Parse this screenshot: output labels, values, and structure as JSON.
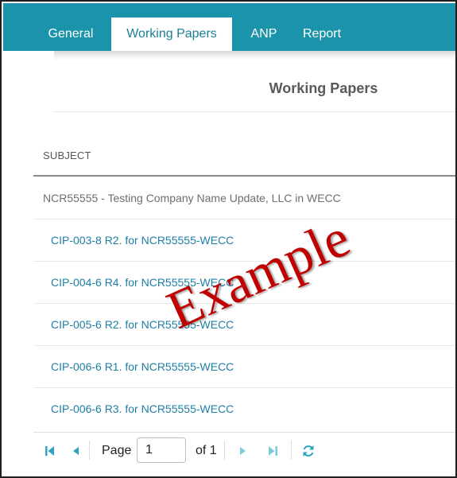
{
  "tabs": [
    {
      "label": "General",
      "active": false
    },
    {
      "label": "Working Papers",
      "active": true
    },
    {
      "label": "ANP",
      "active": false
    },
    {
      "label": "Report",
      "active": false
    }
  ],
  "panel": {
    "title": "Working Papers"
  },
  "table": {
    "column_header": "SUBJECT",
    "group_row": "NCR55555 - Testing Company Name Update, LLC in WECC",
    "rows": [
      "CIP-003-8 R2. for NCR55555-WECC",
      "CIP-004-6 R4. for NCR55555-WECC",
      "CIP-005-6 R2. for NCR55555-WECC",
      "CIP-006-6 R1. for NCR55555-WECC",
      "CIP-006-6 R3. for NCR55555-WECC"
    ]
  },
  "pager": {
    "page_label": "Page",
    "current_page": "1",
    "of_label": "of 1",
    "icons": [
      "first-page-icon",
      "previous-page-icon",
      "next-page-icon",
      "last-page-icon",
      "refresh-icon"
    ]
  },
  "watermark": "Example",
  "colors": {
    "tabbar": "#1b93aa",
    "link": "#1e7fa6",
    "pager_icon": "#2aa3c4",
    "watermark": "#c00000"
  }
}
